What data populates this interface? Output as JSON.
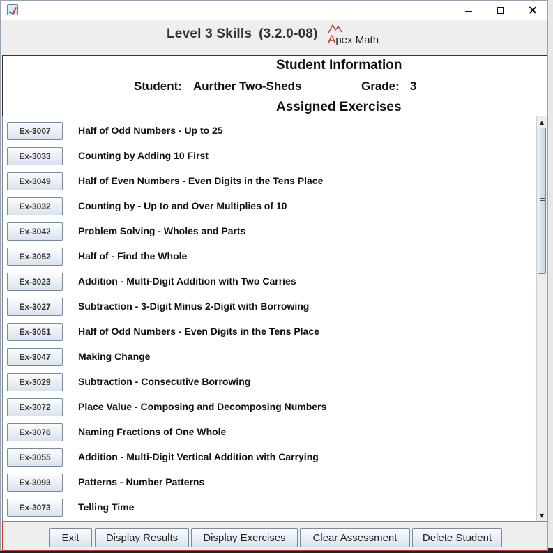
{
  "window": {
    "title": "",
    "minimize_icon": "minimize-icon",
    "maximize_icon": "maximize-icon",
    "close_label": "✕"
  },
  "header": {
    "title": "Level 3 Skills",
    "version": "(3.2.0-08)",
    "logo_text_first": "A",
    "logo_text_rest": "pex Math"
  },
  "student_info": {
    "title": "Student Information",
    "student_label": "Student:",
    "student_name": "Aurther Two-Sheds",
    "grade_label": "Grade:",
    "grade_value": "3",
    "assigned_title": "Assigned Exercises"
  },
  "exercises": [
    {
      "id": "Ex-3007",
      "title": "Half of Odd Numbers - Up to 25"
    },
    {
      "id": "Ex-3033",
      "title": "Counting by Adding 10 First"
    },
    {
      "id": "Ex-3049",
      "title": "Half of Even Numbers - Even Digits in the Tens Place"
    },
    {
      "id": "Ex-3032",
      "title": "Counting by - Up to and Over Multiplies of 10"
    },
    {
      "id": "Ex-3042",
      "title": "Problem Solving - Wholes and Parts"
    },
    {
      "id": "Ex-3052",
      "title": "Half of - Find the Whole"
    },
    {
      "id": "Ex-3023",
      "title": "Addition - Multi-Digit Addition with Two Carries"
    },
    {
      "id": "Ex-3027",
      "title": "Subtraction - 3-Digit Minus 2-Digit with Borrowing"
    },
    {
      "id": "Ex-3051",
      "title": "Half of Odd Numbers - Even Digits in the Tens Place"
    },
    {
      "id": "Ex-3047",
      "title": "Making Change"
    },
    {
      "id": "Ex-3029",
      "title": "Subtraction - Consecutive Borrowing"
    },
    {
      "id": "Ex-3072",
      "title": "Place Value - Composing and Decomposing Numbers"
    },
    {
      "id": "Ex-3076",
      "title": "Naming Fractions of One Whole"
    },
    {
      "id": "Ex-3055",
      "title": "Addition - Multi-Digit Vertical Addition with Carrying"
    },
    {
      "id": "Ex-3093",
      "title": "Patterns - Number Patterns"
    },
    {
      "id": "Ex-3073",
      "title": "Telling Time"
    }
  ],
  "footer": {
    "exit": "Exit",
    "display_results": "Display Results",
    "display_exercises": "Display Exercises",
    "clear_assessment": "Clear Assessment",
    "delete_student": "Delete Student"
  },
  "colors": {
    "accent_red": "#c0392b",
    "button_border": "#7a8a99"
  }
}
